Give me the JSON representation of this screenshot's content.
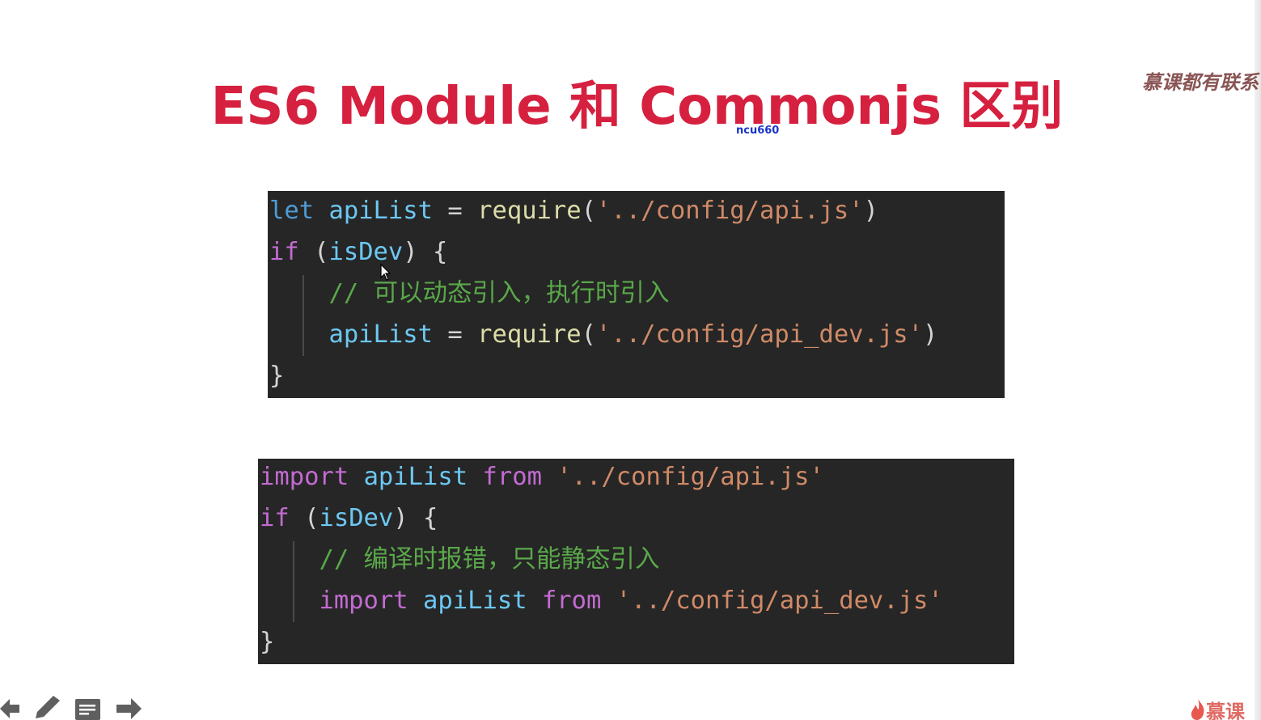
{
  "slide": {
    "title": "ES6 Module 和 Commonjs 区别",
    "watermark_top": "慕课都有联系",
    "watermark_user": "ncu660",
    "brand": "慕课"
  },
  "code_block_1": {
    "lines": [
      [
        {
          "t": "let",
          "c": "kw-let"
        },
        {
          "t": " ",
          "c": "pun"
        },
        {
          "t": "apiList",
          "c": "var"
        },
        {
          "t": " = ",
          "c": "pun"
        },
        {
          "t": "require",
          "c": "fn"
        },
        {
          "t": "(",
          "c": "pun"
        },
        {
          "t": "'../config/api.js'",
          "c": "str"
        },
        {
          "t": ")",
          "c": "pun"
        }
      ],
      [
        {
          "t": "if",
          "c": "kw"
        },
        {
          "t": " (",
          "c": "pun"
        },
        {
          "t": "isDev",
          "c": "var"
        },
        {
          "t": ") {",
          "c": "pun"
        }
      ],
      [
        {
          "t": "    ",
          "c": "pun"
        },
        {
          "t": "// 可以动态引入，执行时引入",
          "c": "cm"
        }
      ],
      [
        {
          "t": "    ",
          "c": "pun"
        },
        {
          "t": "apiList",
          "c": "var"
        },
        {
          "t": " = ",
          "c": "pun"
        },
        {
          "t": "require",
          "c": "fn"
        },
        {
          "t": "(",
          "c": "pun"
        },
        {
          "t": "'../config/api_dev.js'",
          "c": "str"
        },
        {
          "t": ")",
          "c": "pun"
        }
      ],
      [
        {
          "t": "}",
          "c": "pun"
        }
      ]
    ]
  },
  "code_block_2": {
    "lines": [
      [
        {
          "t": "import",
          "c": "kw"
        },
        {
          "t": " ",
          "c": "pun"
        },
        {
          "t": "apiList",
          "c": "var"
        },
        {
          "t": " ",
          "c": "pun"
        },
        {
          "t": "from",
          "c": "kw"
        },
        {
          "t": " ",
          "c": "pun"
        },
        {
          "t": "'../config/api.js'",
          "c": "str"
        }
      ],
      [
        {
          "t": "if",
          "c": "kw"
        },
        {
          "t": " (",
          "c": "pun"
        },
        {
          "t": "isDev",
          "c": "var"
        },
        {
          "t": ") {",
          "c": "pun"
        }
      ],
      [
        {
          "t": "    ",
          "c": "pun"
        },
        {
          "t": "// 编译时报错，只能静态引入",
          "c": "cm"
        }
      ],
      [
        {
          "t": "    ",
          "c": "pun"
        },
        {
          "t": "import",
          "c": "kw"
        },
        {
          "t": " ",
          "c": "pun"
        },
        {
          "t": "apiList",
          "c": "var"
        },
        {
          "t": " ",
          "c": "pun"
        },
        {
          "t": "from",
          "c": "kw"
        },
        {
          "t": " ",
          "c": "pun"
        },
        {
          "t": "'../config/api_dev.js'",
          "c": "str"
        }
      ],
      [
        {
          "t": "}",
          "c": "pun"
        }
      ]
    ]
  },
  "toolbar": {
    "icons": [
      "arrow-left-icon",
      "pen-icon",
      "notes-icon",
      "arrow-right-icon"
    ]
  },
  "colors": {
    "title": "#d6203f",
    "code_background": "#262626",
    "keyword": "#c36bd2",
    "variable": "#6cc8f2",
    "function": "#dcdca8",
    "string": "#d08a67",
    "comment": "#5aa84a"
  }
}
